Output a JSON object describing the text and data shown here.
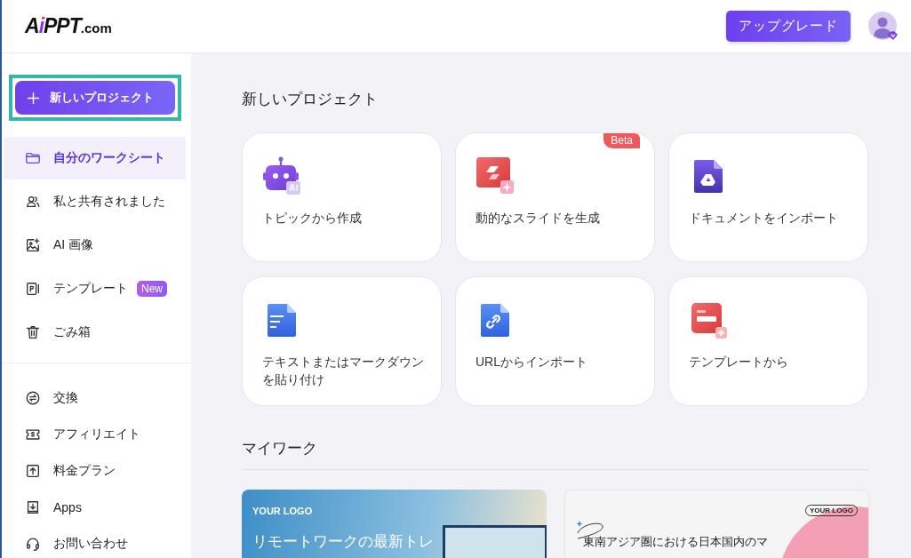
{
  "header": {
    "logo": [
      {
        "text": "A",
        "accent": false
      },
      {
        "text": "i",
        "accent": true
      },
      {
        "text": "PPT",
        "accent": false
      },
      {
        "text": ".com",
        "accent": false
      }
    ],
    "upgrade_button": "アップグレード"
  },
  "sidebar": {
    "new_project_button": "新しいプロジェクト",
    "items": [
      {
        "label": "自分のワークシート",
        "selected": true
      },
      {
        "label": "私と共有されました",
        "selected": false
      },
      {
        "label": "AI 画像",
        "selected": false
      },
      {
        "label": "テンプレート",
        "selected": false,
        "badge": "New"
      },
      {
        "label": "ごみ箱",
        "selected": false
      }
    ],
    "secondary_items": [
      {
        "label": "交換",
        "selected": false
      },
      {
        "label": "アフィリエイト",
        "selected": false
      },
      {
        "label": "料金プラン",
        "selected": false
      },
      {
        "label": "Apps",
        "selected": false
      },
      {
        "label": "お問い合わせ",
        "selected": false
      }
    ]
  },
  "new_project": {
    "title": "新しいプロジェクト",
    "cards": [
      {
        "label": "トピックから作成"
      },
      {
        "label": "動的なスライドを生成",
        "badge": "Beta"
      },
      {
        "label": "ドキュメントをインポート"
      },
      {
        "label": "テキストまたはマークダウンを貼り付け"
      },
      {
        "label": "URLからインポート"
      },
      {
        "label": "テンプレートから"
      }
    ]
  },
  "my_work": {
    "title": "マイワーク",
    "items": [
      {
        "logo": "YOUR LOGO",
        "title": "リモートワークの最新トレ"
      },
      {
        "logo": "YOUR LOGO",
        "title": "東南アジア圏における日本国内のマ"
      }
    ]
  }
}
